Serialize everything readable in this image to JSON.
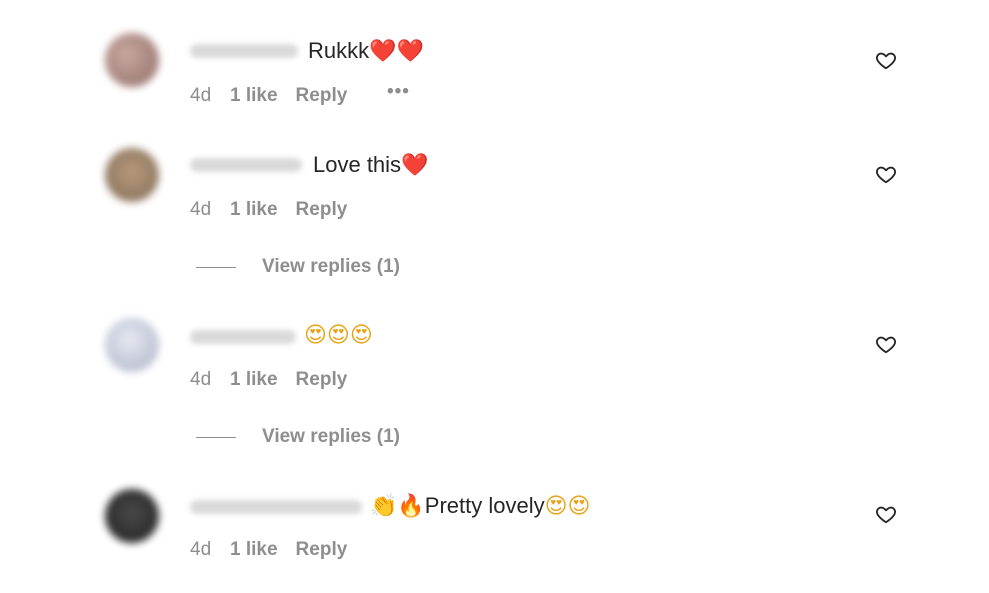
{
  "comments": [
    {
      "text": "Rukkk",
      "emoji_suffix": "❤️❤️",
      "age": "4d",
      "likes": "1 like",
      "reply": "Reply",
      "more": "•••"
    },
    {
      "text": "Love this",
      "emoji_suffix": "❤️",
      "age": "4d",
      "likes": "1 like",
      "reply": "Reply",
      "view_replies": "View replies (1)"
    },
    {
      "text": "",
      "emoji_suffix": "😍😍😍",
      "age": "4d",
      "likes": "1 like",
      "reply": "Reply",
      "view_replies": "View replies (1)"
    },
    {
      "emoji_prefix": "👏🔥",
      "text": "Pretty lovely",
      "emoji_suffix": "😍😍",
      "age": "4d",
      "likes": "1 like",
      "reply": "Reply"
    }
  ],
  "icons": {
    "like": "heart-outline-icon",
    "more": "more-horizontal-icon"
  },
  "colors": {
    "text": "#262626",
    "secondary": "#8e8e8e",
    "heart_emoji": "#e0245e"
  }
}
